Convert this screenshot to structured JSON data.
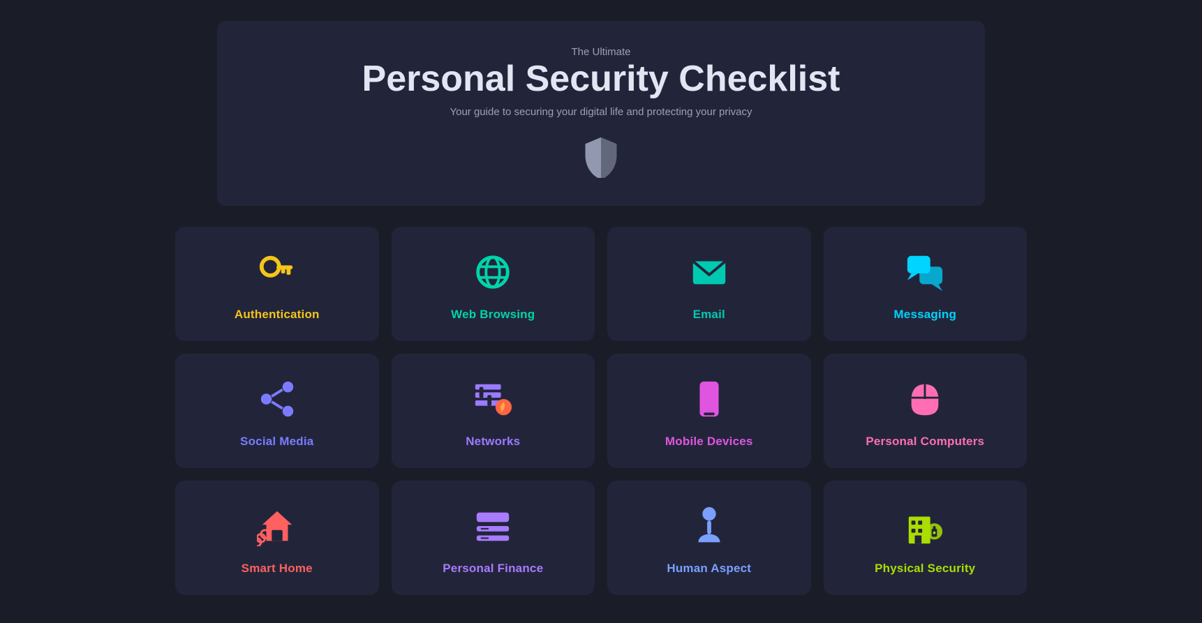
{
  "header": {
    "pretitle": "The Ultimate",
    "title": "Personal Security Checklist",
    "description": "Your guide to securing your digital life and protecting your privacy"
  },
  "cards": [
    {
      "id": "authentication",
      "label": "Authentication",
      "color": "#f5c518",
      "icon": "key"
    },
    {
      "id": "web-browsing",
      "label": "Web Browsing",
      "color": "#00d4aa",
      "icon": "globe"
    },
    {
      "id": "email",
      "label": "Email",
      "color": "#00c9b1",
      "icon": "email"
    },
    {
      "id": "messaging",
      "label": "Messaging",
      "color": "#00d4ff",
      "icon": "chat"
    },
    {
      "id": "social-media",
      "label": "Social Media",
      "color": "#7b7bff",
      "icon": "share"
    },
    {
      "id": "networks",
      "label": "Networks",
      "color": "#9b7bff",
      "icon": "firewall"
    },
    {
      "id": "mobile-devices",
      "label": "Mobile Devices",
      "color": "#e055e0",
      "icon": "mobile"
    },
    {
      "id": "personal-computers",
      "label": "Personal Computers",
      "color": "#ff6eb4",
      "icon": "mouse"
    },
    {
      "id": "smart-home",
      "label": "Smart Home",
      "color": "#ff6060",
      "icon": "smarthome"
    },
    {
      "id": "personal-finance",
      "label": "Personal Finance",
      "color": "#a87bff",
      "icon": "finance"
    },
    {
      "id": "human-aspect",
      "label": "Human Aspect",
      "color": "#7b9fff",
      "icon": "person"
    },
    {
      "id": "physical-security",
      "label": "Physical Security",
      "color": "#aadd00",
      "icon": "building"
    }
  ]
}
